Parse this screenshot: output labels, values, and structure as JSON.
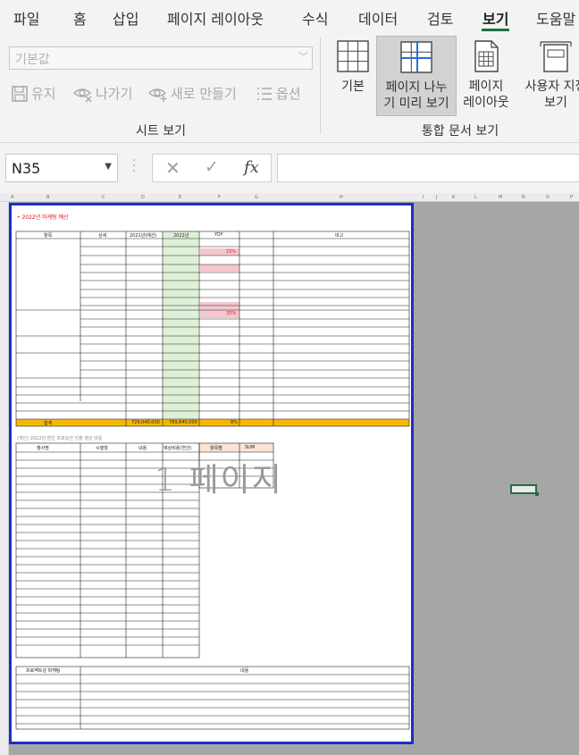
{
  "tabs": [
    {
      "label": "파일",
      "active": false
    },
    {
      "label": "홈",
      "active": false
    },
    {
      "label": "삽입",
      "active": false
    },
    {
      "label": "페이지 레이아웃",
      "active": false
    },
    {
      "label": "수식",
      "active": false
    },
    {
      "label": "데이터",
      "active": false
    },
    {
      "label": "검토",
      "active": false
    },
    {
      "label": "보기",
      "active": true
    },
    {
      "label": "도움말",
      "active": false
    }
  ],
  "sheet_view": {
    "select_value": "기본값",
    "keep_label": "유지",
    "exit_label": "나가기",
    "new_label": "새로 만들기",
    "options_label": "옵션",
    "group_label": "시트 보기"
  },
  "workbook_views": {
    "normal_label": "기본",
    "page_break_label_1": "페이지 나누",
    "page_break_label_2": "기 미리 보기",
    "page_layout_label_1": "페이지",
    "page_layout_label_2": "레이아웃",
    "custom_label_1": "사용자 지정",
    "custom_label_2": "보기",
    "group_label": "통합 문서 보기"
  },
  "formula_bar": {
    "name_box": "N35",
    "cancel_icon": "cancel-icon",
    "enter_icon": "check-icon",
    "fx_label": "fx",
    "formula": ""
  },
  "worksheet": {
    "page_watermark": "1 페이지",
    "selected_cell": "N35",
    "title": "• 2022년 마케팅 예산",
    "table1_headers": [
      "항목",
      "상세",
      "2021년(예산)",
      "2022년",
      "YOY",
      "비고"
    ],
    "yoy_values": {
      "r8": "15%",
      "r15": "33%"
    },
    "total_label": "합계",
    "total_2021": "729,040,000",
    "total_2022": "789,840,000",
    "total_yoy": "8%",
    "table2_caption": "(개인) 2022년 연간 프로모션 지출 생성 비용",
    "table2_headers": [
      "행사명",
      "시행월",
      "내용",
      "예상비용(연간)"
    ],
    "sum_headers": [
      "항목별",
      "SUM"
    ],
    "table3_headers": [
      "프로젝트성 마케팅",
      "내용"
    ]
  },
  "colors": {
    "accent": "#1e7145",
    "page_border": "#1a2fc9",
    "total_bar": "#f7b600",
    "green_column": "#dff0d8",
    "pink_cell": "#f4c7cf",
    "sum_header": "#fbe4d5"
  }
}
